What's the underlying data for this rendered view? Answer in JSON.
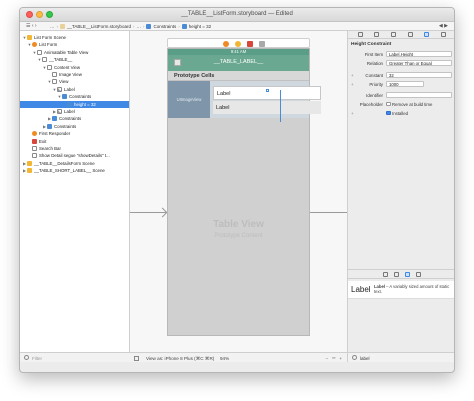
{
  "window": {
    "title": "__TABLE__ListForm.storyboard — Edited"
  },
  "jumpbar": {
    "left_icons": "☰ ‹ ›",
    "crumbs": [
      "…",
      "__TABLE__ListForm.storyboard",
      "…",
      "Constraints",
      "height = 32"
    ],
    "right_icons": "◀ ▶"
  },
  "outline": {
    "rows": [
      {
        "text": "List Form Scene",
        "indent": 0,
        "disc": "▼",
        "icon": "yellow",
        "selected": false
      },
      {
        "text": "List Form",
        "indent": 1,
        "disc": "▼",
        "icon": "orange",
        "selected": false
      },
      {
        "text": "Animatable Table View",
        "indent": 2,
        "disc": "▼",
        "icon": "white",
        "selected": false
      },
      {
        "text": "__TABLE__",
        "indent": 3,
        "disc": "▼",
        "icon": "white",
        "selected": false
      },
      {
        "text": "Content View",
        "indent": 4,
        "disc": "▼",
        "icon": "white",
        "selected": false
      },
      {
        "text": "Image View",
        "indent": 5,
        "disc": "",
        "icon": "white",
        "selected": false
      },
      {
        "text": "View",
        "indent": 5,
        "disc": "▼",
        "icon": "white",
        "selected": false
      },
      {
        "text": "Label",
        "indent": 6,
        "disc": "▼",
        "icon": "label",
        "selected": false
      },
      {
        "text": "Constraints",
        "indent": 7,
        "disc": "▼",
        "icon": "blue",
        "selected": false
      },
      {
        "text": "height = 32",
        "indent": 8,
        "disc": "",
        "icon": "blue",
        "selected": true
      },
      {
        "text": "Label",
        "indent": 6,
        "disc": "▶",
        "icon": "label",
        "selected": false
      },
      {
        "text": "Constraints",
        "indent": 5,
        "disc": "▶",
        "icon": "blue",
        "selected": false
      },
      {
        "text": "Constraints",
        "indent": 4,
        "disc": "▶",
        "icon": "blue",
        "selected": false
      },
      {
        "text": "First Responder",
        "indent": 1,
        "disc": "",
        "icon": "orange",
        "selected": false
      },
      {
        "text": "Exit",
        "indent": 1,
        "disc": "",
        "icon": "red",
        "selected": false
      },
      {
        "text": "Search Bar",
        "indent": 1,
        "disc": "",
        "icon": "white",
        "selected": false
      },
      {
        "text": "Show Detail segue \"showDetails\" t...",
        "indent": 1,
        "disc": "",
        "icon": "white",
        "selected": false
      },
      {
        "text": "__TABLE__DetailsForm Scene",
        "indent": 0,
        "disc": "▶",
        "icon": "yellow",
        "selected": false
      },
      {
        "text": "__TABLE_SHORT_LABEL__ Scene",
        "indent": 0,
        "disc": "▶",
        "icon": "yellow",
        "selected": false
      }
    ],
    "filter_placeholder": "Filter"
  },
  "canvas": {
    "status_time": "9:41 AM",
    "nav_title": "__TABLE_LABEL__",
    "prototype_header": "Prototype Cells",
    "image_view_text": "UIImageView",
    "label1": "Label",
    "label2": "Label",
    "table_view_title": "Table View",
    "table_view_sub": "Prototype Content",
    "view_as": "View as: iPhone 8 Plus (⌘C ⌘R)",
    "zoom": "94%",
    "bottom_right": "− ＝ +"
  },
  "inspector": {
    "section_title": "Height Constraint",
    "first_item_label": "First Item",
    "first_item_value": "Label.Height",
    "relation_label": "Relation",
    "relation_value": "Greater Than or Equal",
    "constant_label": "Constant",
    "constant_value": "32",
    "priority_label": "Priority",
    "priority_value": "1000",
    "identifier_label": "Identifier",
    "identifier_value": "",
    "placeholder_label": "Placeholder",
    "placeholder_check_text": "Remove at build time",
    "installed_text": "Installed",
    "library_item_big": "Label",
    "library_item_name": "Label",
    "library_item_desc": "– A variably sized amount of static text.",
    "library_search_value": "label"
  },
  "colors": {
    "nav_green": "#6aa891",
    "selection_blue": "#3f88e6",
    "image_view_slate": "#7f96aa"
  }
}
